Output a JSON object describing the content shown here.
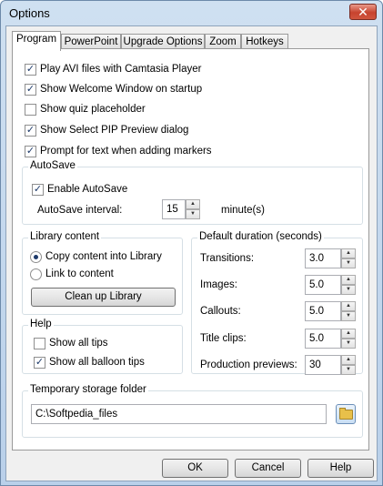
{
  "window": {
    "title": "Options",
    "close_glyph": "✕"
  },
  "tabs": [
    {
      "label": "Program",
      "active": true
    },
    {
      "label": "PowerPoint",
      "active": false
    },
    {
      "label": "Upgrade Options",
      "active": false
    },
    {
      "label": "Zoom",
      "active": false
    },
    {
      "label": "Hotkeys",
      "active": false
    }
  ],
  "options": [
    {
      "label": "Play AVI files with Camtasia Player",
      "checked": true
    },
    {
      "label": "Show Welcome Window on startup",
      "checked": true
    },
    {
      "label": "Show quiz placeholder",
      "checked": false
    },
    {
      "label": "Show Select PIP Preview dialog",
      "checked": true
    },
    {
      "label": "Prompt for text when adding markers",
      "checked": true
    }
  ],
  "autosave": {
    "title": "AutoSave",
    "enable_label": "Enable AutoSave",
    "enable_checked": true,
    "interval_label": "AutoSave interval:",
    "interval_value": "15",
    "interval_unit": "minute(s)"
  },
  "library": {
    "title": "Library content",
    "copy_label": "Copy content into Library",
    "link_label": "Link to content",
    "selected": "copy",
    "cleanup_label": "Clean up Library"
  },
  "help": {
    "title": "Help",
    "show_all_tips": {
      "label": "Show all tips",
      "checked": false
    },
    "show_balloon_tips": {
      "label": "Show all balloon tips",
      "checked": true
    }
  },
  "durations": {
    "title": "Default duration (seconds)",
    "transitions": {
      "label": "Transitions:",
      "value": "3.0"
    },
    "images": {
      "label": "Images:",
      "value": "5.0"
    },
    "callouts": {
      "label": "Callouts:",
      "value": "5.0"
    },
    "title_clips": {
      "label": "Title clips:",
      "value": "5.0"
    },
    "previews": {
      "label": "Production previews:",
      "value": "30"
    }
  },
  "storage": {
    "title": "Temporary storage folder",
    "path": "C:\\Softpedia_files"
  },
  "buttons": {
    "ok": "OK",
    "cancel": "Cancel",
    "help": "Help"
  },
  "glyphs": {
    "check": "✓",
    "up": "▲",
    "down": "▼"
  }
}
